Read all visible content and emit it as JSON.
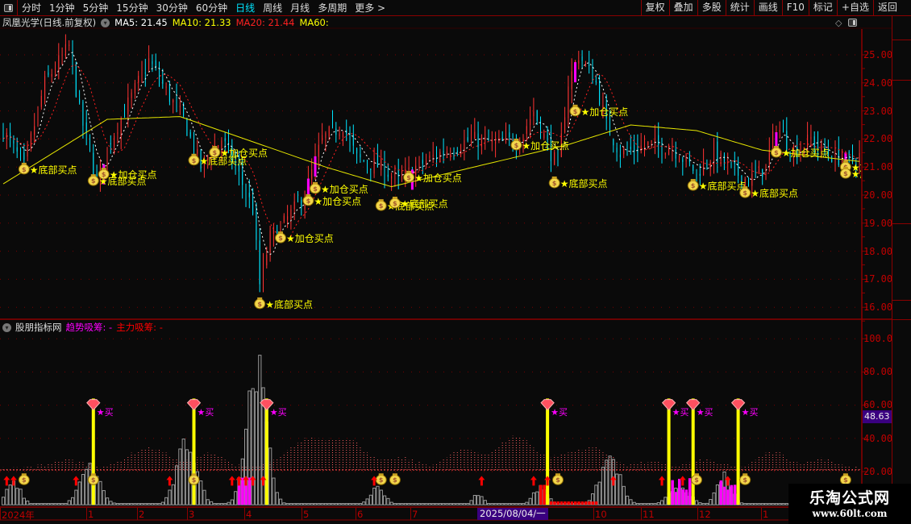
{
  "toolbar": {
    "periods": [
      "分时",
      "1分钟",
      "5分钟",
      "15分钟",
      "30分钟",
      "60分钟",
      "日线",
      "周线",
      "月线",
      "多周期",
      "更多 >"
    ],
    "active_period": "日线",
    "right_buttons": [
      "复权",
      "叠加",
      "多股",
      "统计",
      "画线",
      "F10",
      "标记",
      "+自选",
      "返回"
    ]
  },
  "main": {
    "title": "凤凰光学(日线.前复权)",
    "ma5": "MA5: 21.45",
    "ma10": "MA10: 21.33",
    "ma20": "MA20: 21.44",
    "ma60": "MA60:",
    "colors": {
      "ma5": "#ffffff",
      "ma10": "#ffff00",
      "ma20": "#ff2020",
      "ma60": "#ffff00",
      "up": "#ff3333",
      "down": "#00e5ff",
      "signal": "#ff00ff"
    },
    "price_axis": [
      "25.00",
      "24.00",
      "23.00",
      "22.00",
      "21.00",
      "20.00",
      "19.00",
      "18.00",
      "17.00",
      "16.00"
    ]
  },
  "lower": {
    "title": "股朋指标网",
    "trend_label": "趋势吸筹: -",
    "main_label": "主力吸筹: -",
    "axis": [
      "100.0",
      "80.00",
      "60.00",
      "40.00",
      "20.00"
    ],
    "current_value": "48.63",
    "buy_label": "★买"
  },
  "date_axis": {
    "labels": [
      "2024年",
      "1",
      "2",
      "3",
      "4",
      "5",
      "6",
      "7",
      "10",
      "11",
      "12",
      "1"
    ],
    "cursor_date": "2025/08/04/一"
  },
  "watermark": {
    "name": "乐淘公式网",
    "url": "www.60lt.com"
  },
  "chart_data": {
    "type": "candlestick",
    "ylim": [
      15.8,
      25.8
    ],
    "close_anchors": [
      [
        0,
        22.3
      ],
      [
        6,
        21
      ],
      [
        12,
        24
      ],
      [
        19,
        25.3
      ],
      [
        22,
        23
      ],
      [
        27,
        20.5
      ],
      [
        31,
        22
      ],
      [
        37,
        23.5
      ],
      [
        42,
        24.8
      ],
      [
        48,
        23.5
      ],
      [
        52,
        22.7
      ],
      [
        57,
        21
      ],
      [
        63,
        22
      ],
      [
        67,
        21
      ],
      [
        72,
        19.5
      ],
      [
        74,
        16.8
      ],
      [
        77,
        18.5
      ],
      [
        81,
        19
      ],
      [
        87,
        20
      ],
      [
        92,
        22
      ],
      [
        98,
        22.5
      ],
      [
        102,
        21.3
      ],
      [
        109,
        21
      ],
      [
        114,
        20.5
      ],
      [
        119,
        21
      ],
      [
        126,
        21.5
      ],
      [
        135,
        22
      ],
      [
        142,
        21.8
      ],
      [
        149,
        22
      ],
      [
        153,
        23
      ],
      [
        158,
        21.5
      ],
      [
        160,
        21
      ],
      [
        163,
        24
      ],
      [
        166,
        25
      ],
      [
        171,
        24
      ],
      [
        174,
        22.5
      ],
      [
        178,
        21.5
      ],
      [
        186,
        21.8
      ],
      [
        193,
        21.7
      ],
      [
        200,
        20.8
      ],
      [
        205,
        21.5
      ],
      [
        209,
        21
      ],
      [
        215,
        20.5
      ],
      [
        220,
        21
      ],
      [
        223,
        22.5
      ],
      [
        228,
        21.5
      ],
      [
        233,
        22
      ],
      [
        237,
        21.5
      ],
      [
        244,
        21.2
      ],
      [
        247,
        21.4
      ]
    ],
    "ma60_anchors": [
      [
        0,
        20.4
      ],
      [
        30,
        22.7
      ],
      [
        51,
        22.8
      ],
      [
        93,
        21
      ],
      [
        112,
        20.3
      ],
      [
        163,
        21.8
      ],
      [
        181,
        22.5
      ],
      [
        200,
        22.3
      ],
      [
        219,
        21.6
      ],
      [
        247,
        21.2
      ]
    ],
    "annotations": [
      {
        "i": 6,
        "p": 20.98,
        "label": "底部买点"
      },
      {
        "i": 26,
        "p": 20.57,
        "label": "底部买点"
      },
      {
        "i": 29,
        "p": 20.8,
        "label": "加仓买点"
      },
      {
        "i": 55,
        "p": 21.3,
        "label": "底部买点"
      },
      {
        "i": 61,
        "p": 21.58,
        "label": "加仓买点"
      },
      {
        "i": 74,
        "p": 16.18,
        "label": "底部买点"
      },
      {
        "i": 80,
        "p": 18.53,
        "label": "加仓买点"
      },
      {
        "i": 88,
        "p": 19.86,
        "label": "加仓买点"
      },
      {
        "i": 90,
        "p": 20.29,
        "label": "加仓买点"
      },
      {
        "i": 109,
        "p": 19.68,
        "label": "底部买点"
      },
      {
        "i": 113,
        "p": 19.77,
        "label": "底部买点"
      },
      {
        "i": 117,
        "p": 20.69,
        "label": "加仓买点"
      },
      {
        "i": 148,
        "p": 21.84,
        "label": "加仓买点"
      },
      {
        "i": 159,
        "p": 20.49,
        "label": "底部买点"
      },
      {
        "i": 165,
        "p": 23.05,
        "label": "加仓买点"
      },
      {
        "i": 199,
        "p": 20.4,
        "label": "底部买点"
      },
      {
        "i": 214,
        "p": 20.14,
        "label": "底部买点"
      },
      {
        "i": 223,
        "p": 21.58,
        "label": "加仓买点"
      },
      {
        "i": 243,
        "p": 21.06,
        "label": "加仓买点"
      },
      {
        "i": 243,
        "p": 20.83,
        "label": "底部买点"
      }
    ],
    "buy_signals": [
      26,
      55,
      76,
      157,
      192,
      199,
      212
    ],
    "lower_bags": [
      6,
      26,
      55,
      109,
      113,
      160,
      200,
      214,
      243
    ],
    "red_arrows": [
      1,
      3,
      21,
      48,
      66,
      68,
      70,
      72,
      75,
      107,
      138,
      153,
      157,
      176,
      190,
      196,
      209
    ],
    "volume_clusters": [
      [
        3,
        15,
        3
      ],
      [
        25,
        26,
        4
      ],
      [
        53,
        44,
        4
      ],
      [
        73,
        97,
        4
      ],
      [
        108,
        12,
        3
      ],
      [
        137,
        8,
        2
      ],
      [
        155,
        12,
        3
      ],
      [
        175,
        33,
        4
      ],
      [
        195,
        13,
        4
      ],
      [
        208,
        20,
        3
      ]
    ],
    "magenta_bars": [
      [
        70,
        20,
        4
      ],
      [
        196,
        18,
        6
      ],
      [
        210,
        22,
        6
      ]
    ]
  }
}
